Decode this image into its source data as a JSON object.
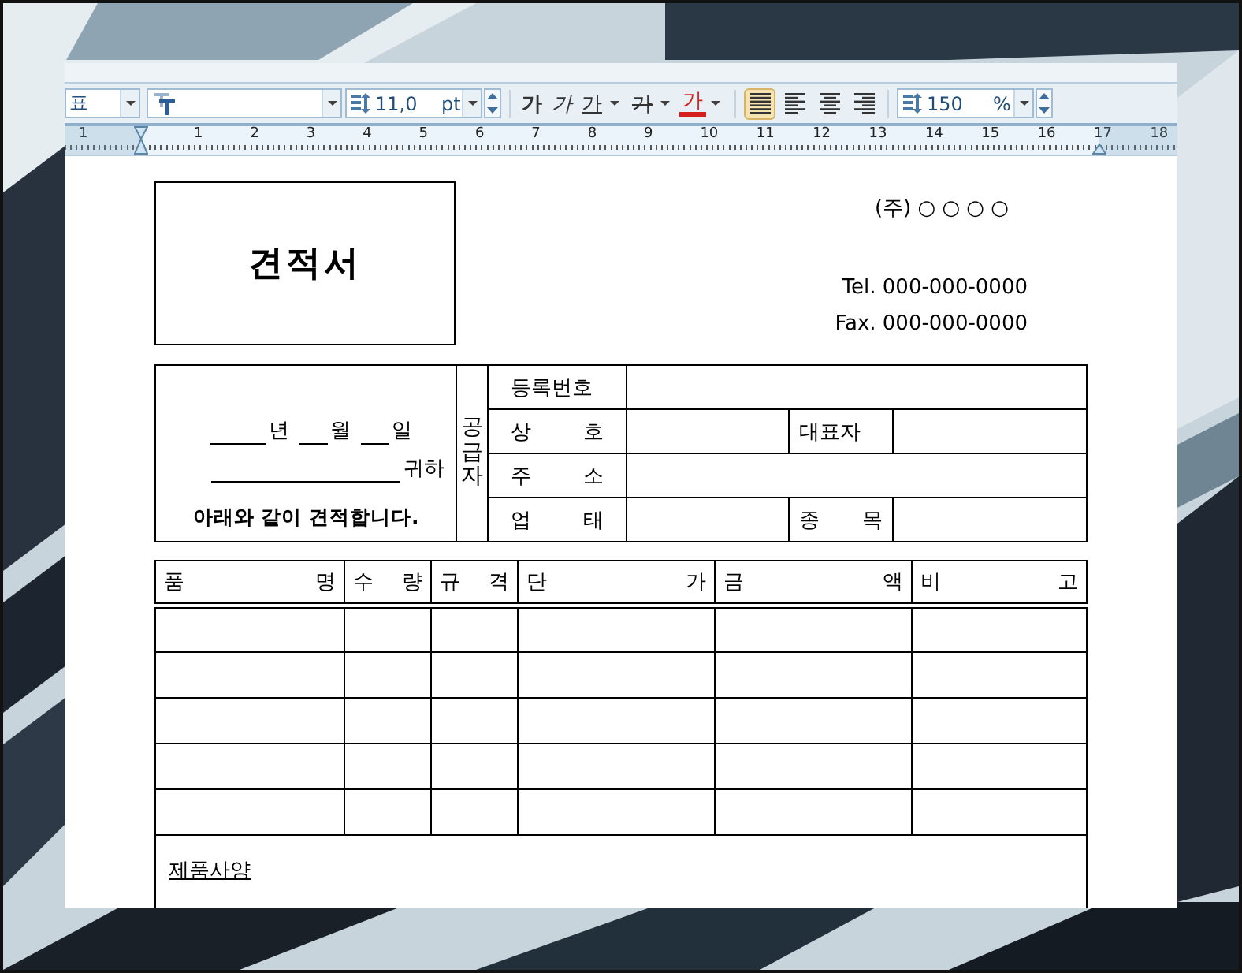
{
  "toolbar": {
    "style_box": {
      "value": "표"
    },
    "size_box": {
      "value": "11,0",
      "unit": "pt"
    },
    "format_buttons": [
      {
        "kind": "bold",
        "label": "가"
      },
      {
        "kind": "italic",
        "label": "가"
      },
      {
        "kind": "underline",
        "label": "가"
      },
      {
        "kind": "strike",
        "label": "가"
      },
      {
        "kind": "color",
        "label": "가"
      }
    ],
    "align_buttons": [
      {
        "kind": "justify",
        "selected": true
      },
      {
        "kind": "left",
        "selected": false
      },
      {
        "kind": "center",
        "selected": false
      },
      {
        "kind": "right",
        "selected": false
      }
    ],
    "spacing_box": {
      "value": "150",
      "unit": "%"
    }
  },
  "ruler": {
    "labels": [
      "1",
      "1",
      "2",
      "3",
      "4",
      "5",
      "6",
      "7",
      "8",
      "9",
      "10",
      "11",
      "12",
      "13",
      "14",
      "15",
      "16",
      "17",
      "18"
    ]
  },
  "document": {
    "title": "견적서",
    "company": "(주) ○ ○ ○ ○",
    "tel": "Tel. 000-000-0000",
    "fax": "Fax. 000-000-0000",
    "customer": {
      "date_labels": [
        "년",
        "월",
        "일"
      ],
      "addressee_suffix": "귀하",
      "statement": "아래와 같이 견적합니다."
    },
    "supplier": {
      "heading": "공급자",
      "rows": [
        {
          "label": "등록번호"
        },
        {
          "label": "상 호",
          "extra_label": "대표자"
        },
        {
          "label": "주 소"
        },
        {
          "label": "업 태",
          "extra_label": "종 목"
        }
      ]
    },
    "items_table": {
      "columns": [
        "품 명",
        "수 량",
        "규 격",
        "단 가",
        "금 액",
        "비 고"
      ],
      "rows": [
        {
          "kind": "blank"
        },
        {
          "kind": "blank"
        },
        {
          "kind": "blank"
        },
        {
          "kind": "blank"
        },
        {
          "kind": "blank"
        }
      ],
      "notes_label": "제품사양"
    }
  }
}
